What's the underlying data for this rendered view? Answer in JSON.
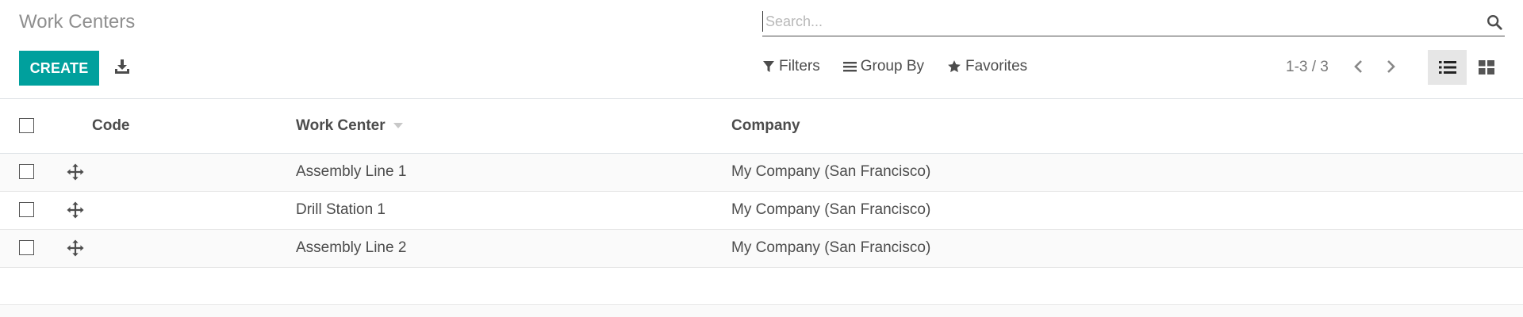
{
  "breadcrumb": {
    "title": "Work Centers"
  },
  "search": {
    "placeholder": "Search...",
    "value": ""
  },
  "toolbar": {
    "create_label": "CREATE",
    "export_icon": "download-icon"
  },
  "filters": {
    "filters_label": "Filters",
    "group_by_label": "Group By",
    "favorites_label": "Favorites"
  },
  "pager": {
    "text": "1-3 / 3"
  },
  "table": {
    "headers": {
      "code": "Code",
      "work_center": "Work Center",
      "company": "Company"
    },
    "rows": [
      {
        "code": "",
        "work_center": "Assembly Line 1",
        "company": "My Company (San Francisco)"
      },
      {
        "code": "",
        "work_center": "Drill Station 1",
        "company": "My Company (San Francisco)"
      },
      {
        "code": "",
        "work_center": "Assembly Line 2",
        "company": "My Company (San Francisco)"
      }
    ]
  },
  "colors": {
    "accent": "#00a09d",
    "text": "#4c4c4c",
    "muted": "#8f8f8f"
  }
}
